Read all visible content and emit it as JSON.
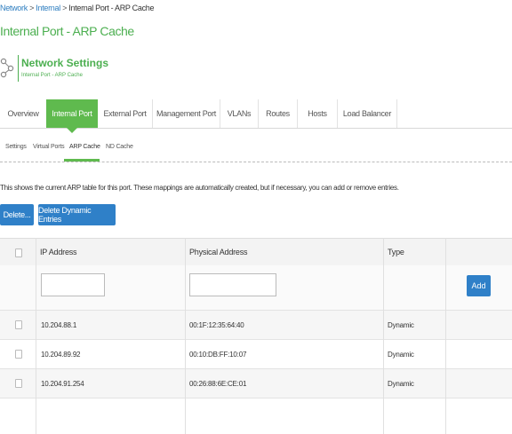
{
  "breadcrumb": {
    "item1": "Network",
    "item2": "Internal",
    "current": "Internal Port - ARP Cache",
    "separator": ">"
  },
  "page_title": "Internal Port - ARP Cache",
  "section": {
    "title": "Network Settings",
    "subtitle": "Internal Port - ARP Cache",
    "icon": "network-nodes-icon"
  },
  "tabs": [
    {
      "label": "Overview",
      "active": false
    },
    {
      "label": "Internal Port",
      "active": true
    },
    {
      "label": "External Port",
      "active": false
    },
    {
      "label": "Management Port",
      "active": false
    },
    {
      "label": "VLANs",
      "active": false
    },
    {
      "label": "Routes",
      "active": false
    },
    {
      "label": "Hosts",
      "active": false
    },
    {
      "label": "Load Balancer",
      "active": false
    }
  ],
  "subtabs": [
    {
      "label": "Settings",
      "active": false
    },
    {
      "label": "Virtual Ports",
      "active": false
    },
    {
      "label": "ARP Cache",
      "active": true
    },
    {
      "label": "ND Cache",
      "active": false
    }
  ],
  "description": "This shows the current ARP table for this port. These mappings are automatically created, but if necessary, you can add or remove entries.",
  "buttons": {
    "delete": "Delete...",
    "delete_dynamic": "Delete Dynamic Entries",
    "add": "Add"
  },
  "table": {
    "headers": {
      "ip": "IP Address",
      "mac": "Physical Address",
      "type": "Type"
    },
    "new_entry": {
      "ip": "",
      "mac": ""
    },
    "rows": [
      {
        "ip": "10.204.88.1",
        "mac": "00:1F:12:35:64:40",
        "type": "Dynamic"
      },
      {
        "ip": "10.204.89.92",
        "mac": "00:10:DB:FF:10:07",
        "type": "Dynamic"
      },
      {
        "ip": "10.204.91.254",
        "mac": "00:26:88:6E:CE:01",
        "type": "Dynamic"
      }
    ]
  },
  "colors": {
    "accent_green": "#5fba4e",
    "title_green": "#4caf50",
    "button_blue": "#2f80c8",
    "link_blue": "#2e7ec0"
  }
}
